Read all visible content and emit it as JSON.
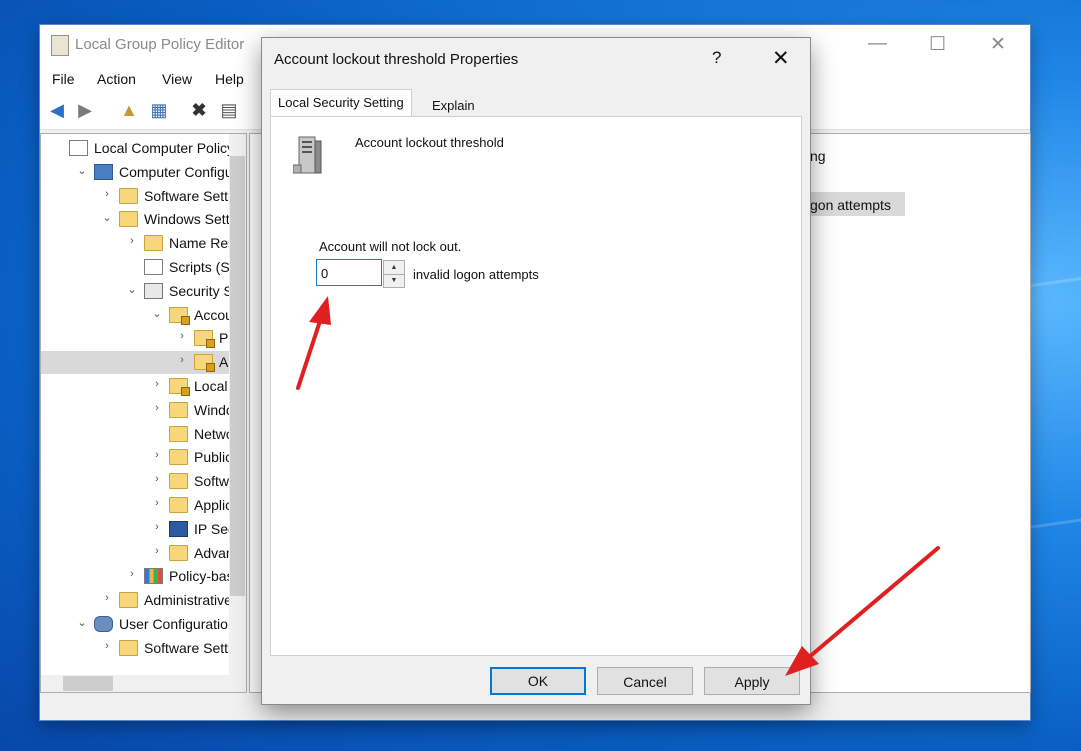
{
  "gpe": {
    "title": "Local Group Policy Editor",
    "window_controls": {
      "minimize": "—",
      "maximize": "☐",
      "close": "✕"
    },
    "menu": [
      "File",
      "Action",
      "View",
      "Help"
    ],
    "tree": [
      {
        "label": "Local Computer Policy",
        "indent": 0,
        "chevron": "",
        "icon": "doc"
      },
      {
        "label": "Computer Configuration",
        "indent": 1,
        "chevron": "⌄",
        "icon": "computer"
      },
      {
        "label": "Software Settings",
        "indent": 2,
        "chevron": "›",
        "icon": "folder"
      },
      {
        "label": "Windows Settings",
        "indent": 2,
        "chevron": "⌄",
        "icon": "folder"
      },
      {
        "label": "Name Resolution Policy",
        "indent": 3,
        "chevron": "›",
        "icon": "folder"
      },
      {
        "label": "Scripts (Startup/Shutdown)",
        "indent": 3,
        "chevron": "",
        "icon": "doc"
      },
      {
        "label": "Security Settings",
        "indent": 3,
        "chevron": "⌄",
        "icon": "shield"
      },
      {
        "label": "Account Policies",
        "indent": 4,
        "chevron": "⌄",
        "icon": "folderlock"
      },
      {
        "label": "Password Policy",
        "indent": 5,
        "chevron": "›",
        "icon": "folderlock"
      },
      {
        "label": "Account Lockout Policy",
        "indent": 5,
        "chevron": "›",
        "icon": "folderlock",
        "selected": true
      },
      {
        "label": "Local Policies",
        "indent": 4,
        "chevron": "›",
        "icon": "folderlock"
      },
      {
        "label": "Windows Defender Firewall",
        "indent": 4,
        "chevron": "›",
        "icon": "folder"
      },
      {
        "label": "Network List Manager Policies",
        "indent": 4,
        "chevron": "",
        "icon": "folder"
      },
      {
        "label": "Public Key Policies",
        "indent": 4,
        "chevron": "›",
        "icon": "folder"
      },
      {
        "label": "Software Restriction Policies",
        "indent": 4,
        "chevron": "›",
        "icon": "folder"
      },
      {
        "label": "Application Control Policies",
        "indent": 4,
        "chevron": "›",
        "icon": "folder"
      },
      {
        "label": "IP Security Policies",
        "indent": 4,
        "chevron": "›",
        "icon": "ipsec"
      },
      {
        "label": "Advanced Audit Policy",
        "indent": 4,
        "chevron": "›",
        "icon": "folder"
      },
      {
        "label": "Policy-based QoS",
        "indent": 3,
        "chevron": "›",
        "icon": "chart"
      },
      {
        "label": "Administrative Templates",
        "indent": 2,
        "chevron": "›",
        "icon": "folder"
      },
      {
        "label": "User Configuration",
        "indent": 1,
        "chevron": "⌄",
        "icon": "user"
      },
      {
        "label": "Software Settings",
        "indent": 2,
        "chevron": "›",
        "icon": "folder"
      }
    ],
    "right_pane": {
      "col_header_partial": "ng",
      "row_partial": "gon attempts"
    }
  },
  "dialog": {
    "title": "Account lockout threshold Properties",
    "help": "?",
    "close": "✕",
    "tabs": [
      "Local Security Setting",
      "Explain"
    ],
    "setting_name": "Account lockout threshold",
    "info": "Account will not lock out.",
    "value": "0",
    "unit_label": "invalid logon attempts",
    "buttons": {
      "ok": "OK",
      "cancel": "Cancel",
      "apply": "Apply"
    }
  }
}
